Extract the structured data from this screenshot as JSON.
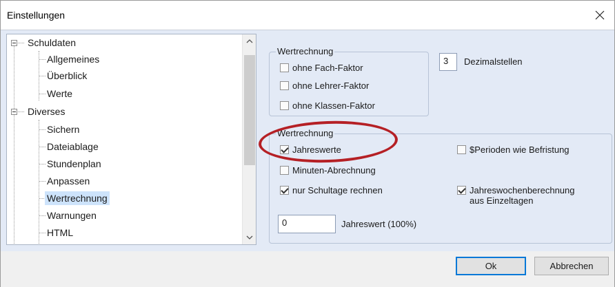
{
  "window": {
    "title": "Einstellungen"
  },
  "tree": {
    "items": [
      {
        "label": "Schuldaten",
        "level": 0,
        "expanded": true
      },
      {
        "label": "Allgemeines",
        "level": 1
      },
      {
        "label": "Überblick",
        "level": 1
      },
      {
        "label": "Werte",
        "level": 1
      },
      {
        "label": "Diverses",
        "level": 0,
        "expanded": true
      },
      {
        "label": "Sichern",
        "level": 1
      },
      {
        "label": "Dateiablage",
        "level": 1
      },
      {
        "label": "Stundenplan",
        "level": 1
      },
      {
        "label": "Anpassen",
        "level": 1
      },
      {
        "label": "Wertrechnung",
        "level": 1,
        "selected": true
      },
      {
        "label": "Warnungen",
        "level": 1
      },
      {
        "label": "HTML",
        "level": 1
      }
    ]
  },
  "group1": {
    "legend": "Wertrechnung",
    "options": [
      {
        "label": "ohne Fach-Faktor",
        "checked": false
      },
      {
        "label": "ohne Lehrer-Faktor",
        "checked": false
      },
      {
        "label": "ohne Klassen-Faktor",
        "checked": false
      }
    ]
  },
  "decimals": {
    "value": "3",
    "label": "Dezimalstellen"
  },
  "group2": {
    "legend": "Wertrechnung",
    "options": {
      "jahreswerte": {
        "label": "Jahreswerte",
        "checked": true
      },
      "minuten": {
        "label": "Minuten-Abrechnung",
        "checked": false
      },
      "schultage": {
        "label": "nur Schultage rechnen",
        "checked": true
      },
      "perioden": {
        "label": "$Perioden wie Befristung",
        "checked": false
      },
      "jahreswochen": {
        "label_line1": "Jahreswochenberechnung",
        "label_line2": "aus Einzeltagen",
        "checked": true
      }
    },
    "jahreswert": {
      "value": "0",
      "label": "Jahreswert (100%)"
    }
  },
  "buttons": {
    "ok": "Ok",
    "cancel": "Abbrechen"
  },
  "colors": {
    "annotation": "#b52025",
    "selection": "#cde3fb",
    "client_bg": "#e3eaf6"
  }
}
